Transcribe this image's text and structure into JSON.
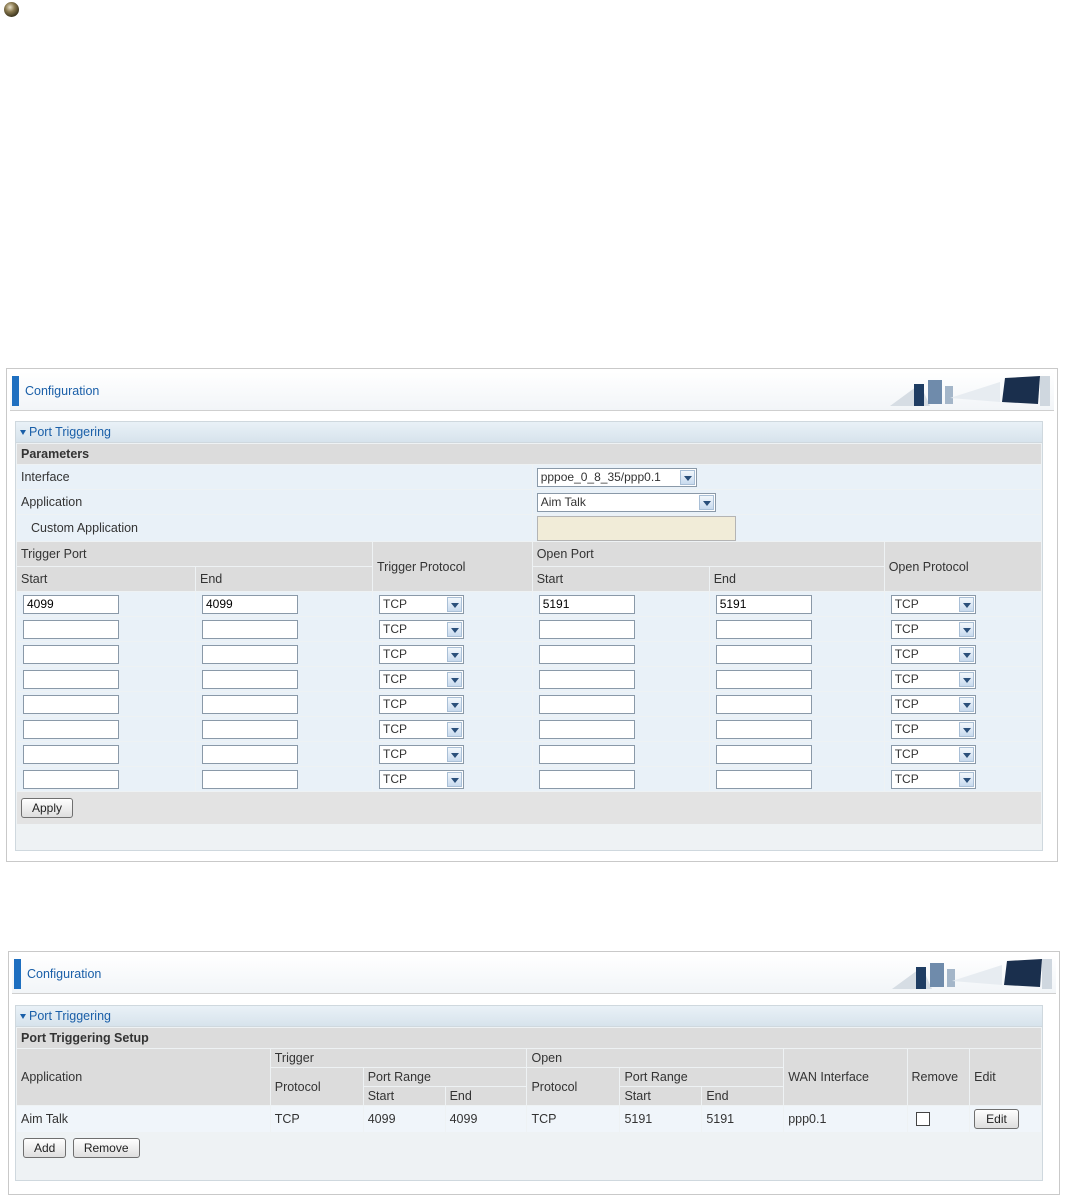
{
  "config_panel_1": {
    "header_title": "Configuration",
    "section_title": "Port Triggering",
    "parameters_label": "Parameters",
    "interface_label": "Interface",
    "interface_value": "pppoe_0_8_35/ppp0.1",
    "application_label": "Application",
    "application_value": "Aim Talk",
    "custom_application_label": "Custom Application",
    "custom_application_value": "",
    "trigger_port_label": "Trigger Port",
    "trigger_protocol_label": "Trigger Protocol",
    "open_port_label": "Open Port",
    "open_protocol_label": "Open Protocol",
    "start_label": "Start",
    "end_label": "End",
    "rows": [
      {
        "trigger_start": "4099",
        "trigger_end": "4099",
        "trigger_protocol": "TCP",
        "open_start": "5191",
        "open_end": "5191",
        "open_protocol": "TCP"
      },
      {
        "trigger_start": "",
        "trigger_end": "",
        "trigger_protocol": "TCP",
        "open_start": "",
        "open_end": "",
        "open_protocol": "TCP"
      },
      {
        "trigger_start": "",
        "trigger_end": "",
        "trigger_protocol": "TCP",
        "open_start": "",
        "open_end": "",
        "open_protocol": "TCP"
      },
      {
        "trigger_start": "",
        "trigger_end": "",
        "trigger_protocol": "TCP",
        "open_start": "",
        "open_end": "",
        "open_protocol": "TCP"
      },
      {
        "trigger_start": "",
        "trigger_end": "",
        "trigger_protocol": "TCP",
        "open_start": "",
        "open_end": "",
        "open_protocol": "TCP"
      },
      {
        "trigger_start": "",
        "trigger_end": "",
        "trigger_protocol": "TCP",
        "open_start": "",
        "open_end": "",
        "open_protocol": "TCP"
      },
      {
        "trigger_start": "",
        "trigger_end": "",
        "trigger_protocol": "TCP",
        "open_start": "",
        "open_end": "",
        "open_protocol": "TCP"
      },
      {
        "trigger_start": "",
        "trigger_end": "",
        "trigger_protocol": "TCP",
        "open_start": "",
        "open_end": "",
        "open_protocol": "TCP"
      }
    ],
    "apply_label": "Apply"
  },
  "config_panel_2": {
    "header_title": "Configuration",
    "section_title": "Port Triggering",
    "setup_label": "Port Triggering Setup",
    "headers": {
      "application": "Application",
      "trigger": "Trigger",
      "open": "Open",
      "protocol": "Protocol",
      "port_range": "Port Range",
      "start": "Start",
      "end": "End",
      "wan_interface": "WAN Interface",
      "remove": "Remove",
      "edit": "Edit"
    },
    "entries": [
      {
        "application": "Aim Talk",
        "trigger_protocol": "TCP",
        "trigger_start": "4099",
        "trigger_end": "4099",
        "open_protocol": "TCP",
        "open_start": "5191",
        "open_end": "5191",
        "wan_interface": "ppp0.1",
        "edit_label": "Edit"
      }
    ],
    "add_label": "Add",
    "remove_label": "Remove"
  },
  "colors": {
    "accent": "#1e6fc0",
    "title_text": "#1a5fa8",
    "row_bg": "#e9f1f8",
    "header_bg": "#dcdcdc"
  },
  "icons": [
    "bullet-icon",
    "dropdown-arrow-icon",
    "computer-monitor-decoration"
  ]
}
